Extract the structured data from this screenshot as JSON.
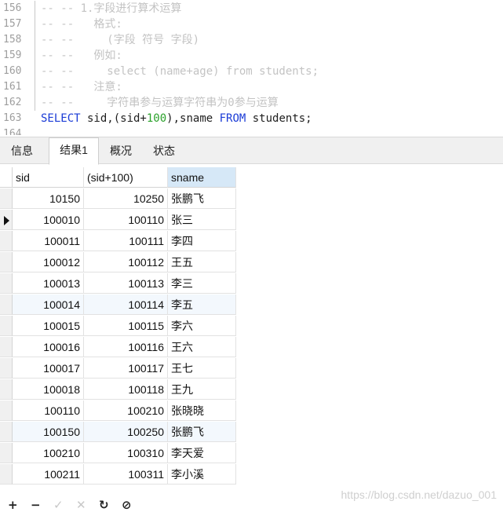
{
  "editor": {
    "lines": [
      {
        "num": "156",
        "segments": [
          {
            "t": "-- -- 1.字段进行算术运算",
            "c": "comment"
          }
        ]
      },
      {
        "num": "157",
        "segments": [
          {
            "t": "-- --   格式:",
            "c": "comment"
          }
        ]
      },
      {
        "num": "158",
        "segments": [
          {
            "t": "-- --     (字段 符号 字段)",
            "c": "comment"
          }
        ]
      },
      {
        "num": "159",
        "segments": [
          {
            "t": "-- --   例如:",
            "c": "comment"
          }
        ]
      },
      {
        "num": "160",
        "segments": [
          {
            "t": "-- --     select (name+age) from students;",
            "c": "comment"
          }
        ]
      },
      {
        "num": "161",
        "segments": [
          {
            "t": "-- --   注意:",
            "c": "comment"
          }
        ]
      },
      {
        "num": "162",
        "segments": [
          {
            "t": "-- --     字符串参与运算字符串为0参与运算",
            "c": "comment"
          }
        ]
      },
      {
        "num": "163",
        "segments": [
          {
            "t": "SELECT",
            "c": "kw"
          },
          {
            "t": " sid,(sid+",
            "c": "plain"
          },
          {
            "t": "100",
            "c": "num"
          },
          {
            "t": "),sname ",
            "c": "plain"
          },
          {
            "t": "FROM",
            "c": "kw"
          },
          {
            "t": " students;",
            "c": "plain"
          }
        ]
      },
      {
        "num": "164",
        "segments": []
      }
    ]
  },
  "tabs": [
    {
      "label": "信息",
      "active": false
    },
    {
      "label": "结果1",
      "active": true
    },
    {
      "label": "概况",
      "active": false
    },
    {
      "label": "状态",
      "active": false
    }
  ],
  "grid": {
    "columns": [
      "sid",
      "(sid+100)",
      "sname"
    ],
    "rows": [
      {
        "sid": "10150",
        "calc": "10250",
        "sname": "张鹏飞"
      },
      {
        "sid": "100010",
        "calc": "100110",
        "sname": "张三"
      },
      {
        "sid": "100011",
        "calc": "100111",
        "sname": "李四"
      },
      {
        "sid": "100012",
        "calc": "100112",
        "sname": "王五"
      },
      {
        "sid": "100013",
        "calc": "100113",
        "sname": "李三"
      },
      {
        "sid": "100014",
        "calc": "100114",
        "sname": "李五"
      },
      {
        "sid": "100015",
        "calc": "100115",
        "sname": "李六"
      },
      {
        "sid": "100016",
        "calc": "100116",
        "sname": "王六"
      },
      {
        "sid": "100017",
        "calc": "100117",
        "sname": "王七"
      },
      {
        "sid": "100018",
        "calc": "100118",
        "sname": "王九"
      },
      {
        "sid": "100110",
        "calc": "100210",
        "sname": "张晓晓"
      },
      {
        "sid": "100150",
        "calc": "100250",
        "sname": "张鹏飞"
      },
      {
        "sid": "100210",
        "calc": "100310",
        "sname": "李天爱"
      },
      {
        "sid": "100211",
        "calc": "100311",
        "sname": "李小溪"
      }
    ],
    "current_row_index": 1,
    "tinted_rows": [
      5,
      11
    ]
  },
  "toolbar": {
    "icons": [
      {
        "name": "add-icon",
        "glyph": "+",
        "enabled": true
      },
      {
        "name": "remove-icon",
        "glyph": "−",
        "enabled": true
      },
      {
        "name": "apply-icon",
        "glyph": "✓",
        "enabled": false
      },
      {
        "name": "discard-icon",
        "glyph": "✕",
        "enabled": false
      },
      {
        "name": "refresh-icon",
        "glyph": "↻",
        "enabled": true
      },
      {
        "name": "stop-icon",
        "glyph": "⊘",
        "enabled": true
      }
    ]
  },
  "watermark": "https://blog.csdn.net/dazuo_001"
}
